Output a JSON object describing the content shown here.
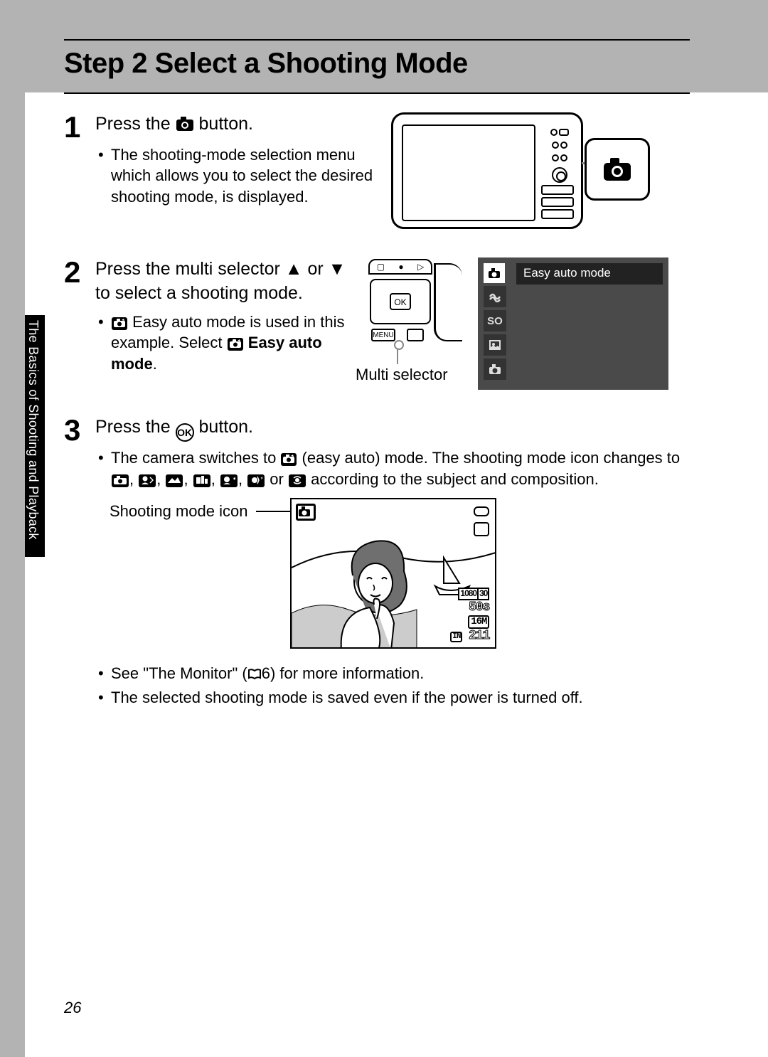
{
  "title": "Step 2 Select a Shooting Mode",
  "side_tab": "The Basics of Shooting and Playback",
  "page_number": "26",
  "steps": {
    "s1": {
      "num": "1",
      "lead_a": "Press the ",
      "lead_b": " button.",
      "bul1": "The shooting-mode selection menu which allows you to select the desired shooting mode, is displayed."
    },
    "s2": {
      "num": "2",
      "lead_a": "Press the multi selector ",
      "lead_b": " or ",
      "lead_c": " to select a shooting mode.",
      "bul1_a": " Easy auto mode is used in this example. Select ",
      "bul1_b": "Easy auto mode",
      "bul1_c": ".",
      "multi_label": "Multi selector",
      "menu": {
        "title": "Easy auto mode",
        "items": [
          "●",
          "⚡",
          "SO",
          "◧",
          "●"
        ]
      }
    },
    "s3": {
      "num": "3",
      "lead_a": "Press the ",
      "lead_b": " button.",
      "bul1_a": "The camera switches to ",
      "bul1_b": " (easy auto) mode. The shooting mode icon changes to ",
      "bul1_c": " or ",
      "bul1_d": " according to the subject and composition.",
      "monitor_label": "Shooting mode icon",
      "monitor": {
        "vid": "1080",
        "fps": "30",
        "time": "50s",
        "size": "16M",
        "in": "IN",
        "shots": "211"
      },
      "bul2_a": "See \"The Monitor\" (",
      "bul2_b": "6) for more information.",
      "bul3": "The selected shooting mode is saved even if the power is turned off."
    }
  }
}
